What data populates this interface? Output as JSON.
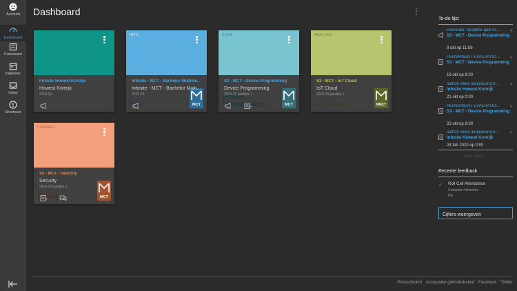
{
  "nav": {
    "items": [
      {
        "label": "Account",
        "icon": "account-icon"
      },
      {
        "label": "Dashboard",
        "icon": "dashboard-icon"
      },
      {
        "label": "Cursussen",
        "icon": "courses-icon"
      },
      {
        "label": "Kalender",
        "icon": "calendar-icon"
      },
      {
        "label": "Inbox",
        "icon": "inbox-icon"
      },
      {
        "label": "Shortcuts",
        "icon": "help-icon"
      }
    ],
    "active_color": "#4aa3df"
  },
  "header": {
    "title": "Dashboard"
  },
  "cards": [
    {
      "category": "",
      "big_title": "",
      "course": "Infosite Howest Kortrijk",
      "name": "Howest Kortrijk",
      "term": "2019-20",
      "color": "#0f9488",
      "course_color": "#4aa3df",
      "has_logo": false
    },
    {
      "category": "INFO",
      "big_title": "Info",
      "course": "Infosite - MCT - Bachelor Multime...",
      "name": "Infosite - MCT - Bachelor Multi...",
      "term": "2019-20",
      "color": "#5aaee0",
      "course_color": "#4aa3df",
      "has_logo": true,
      "logo_text": "MCT"
    },
    {
      "category": "CODE",
      "big_title": "Device Programming",
      "course": "S3 - MCT - Device Programming",
      "name": "Device Programming",
      "term": "2019-20 jaarlijks 1",
      "color": "#78c4d0",
      "course_color": "#4aa3df",
      "has_logo": true,
      "logo_text": "MCT"
    },
    {
      "category": "ANALYSIS",
      "big_title": "IoT Cloud",
      "course": "S3 - MCT - IoT Cloud",
      "name": "IoT Cloud",
      "term": "2019-20 jaarlijks 1",
      "color": "#b9c46e",
      "course_color": "#c3c24b",
      "has_logo": true,
      "logo_text": "NMCT"
    },
    {
      "category": "CONNECT",
      "big_title": "Security",
      "course": "S3 - MCT - Security",
      "name": "Security",
      "term": "2019-20 jaarlijks 1",
      "color": "#f5a07c",
      "course_color": "#e8874f",
      "has_logo": true,
      "logo_text": "MCT"
    }
  ],
  "todo": {
    "title": "To-do lijst",
    "items": [
      {
        "title": "Reminder: deadline quiz m...",
        "course": "S3 - MCT - Device Programming",
        "date": "8 okt op 11:59",
        "icon": "announcement-icon"
      },
      {
        "title": "PERMANENT EVALUATIO...",
        "course": "S3 - MCT - Device Programming",
        "date": "16 okt op 8:30",
        "icon": "assignment-icon"
      },
      {
        "title": "laatste week aanpassing tr...",
        "course": "Infosite Howest Kortrijk",
        "date": "21 okt op 0:00",
        "icon": "assignment-icon"
      },
      {
        "title": "PERMANENT EVALUATIO...",
        "course": "S3 - MCT - Device Programming",
        "date": "23 okt op 8:30",
        "icon": "assignment-icon"
      },
      {
        "title": "laatste week aanpassing tr...",
        "course": "Infosite Howest Kortrijk",
        "date": "24 feb 2020 op 0:00",
        "icon": "assignment-icon"
      }
    ],
    "show_all": "Alles tonen"
  },
  "feedback": {
    "title": "Recente feedback",
    "item_name": "Roll Call Attendance",
    "item_course": "Computer Networks",
    "item_grade": "0%"
  },
  "grades_button": "Cijfers weergeven",
  "footer": [
    "Privacybeleid",
    "Acceptabel gebruiksbeleid",
    "Facebook",
    "Twitter"
  ]
}
